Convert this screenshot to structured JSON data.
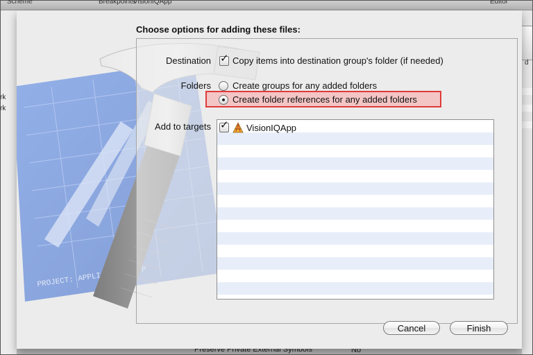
{
  "background": {
    "toolbar_labels": [
      "Scheme",
      "Breakpoints",
      "VisionIQApp",
      "Editor"
    ],
    "left_fragments": [
      "rk",
      "rk"
    ],
    "right_fragment": "d",
    "bottom_fragments": [
      "Preserve Private External Symbols",
      "No ⌃"
    ]
  },
  "sheet": {
    "title": "Choose options for adding these files:",
    "destination": {
      "label": "Destination",
      "option_label": "Copy items into destination group's folder (if needed)",
      "checked": true
    },
    "folders": {
      "label": "Folders",
      "options": [
        {
          "label": "Create groups for any added folders",
          "selected": false
        },
        {
          "label": "Create folder references for any added folders",
          "selected": true
        }
      ]
    },
    "targets": {
      "label": "Add to targets",
      "items": [
        {
          "label": "VisionIQApp",
          "checked": true,
          "icon": "app-target-icon"
        }
      ]
    },
    "buttons": {
      "cancel": "Cancel",
      "finish": "Finish"
    }
  },
  "colors": {
    "highlight_border": "#e03a3a",
    "list_stripe": "#e8eef9",
    "blueprint": "#3f6fd6"
  }
}
